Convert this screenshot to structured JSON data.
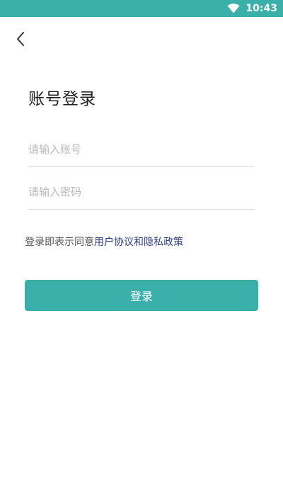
{
  "status_bar": {
    "time": "10:43",
    "wifi_icon": "wifi-icon",
    "background_color": "#3ab0aa"
  },
  "nav": {
    "back_icon": "chevron-left-icon"
  },
  "page": {
    "title": "账号登录"
  },
  "form": {
    "account_placeholder": "请输入账号",
    "account_value": "",
    "password_placeholder": "请输入密码",
    "password_value": ""
  },
  "agreement": {
    "prefix": "登录即表示同意",
    "link": "用户协议和隐私政策",
    "link_color": "#2d3a8c"
  },
  "login_button": {
    "label": "登录",
    "color": "#3ab0aa"
  }
}
